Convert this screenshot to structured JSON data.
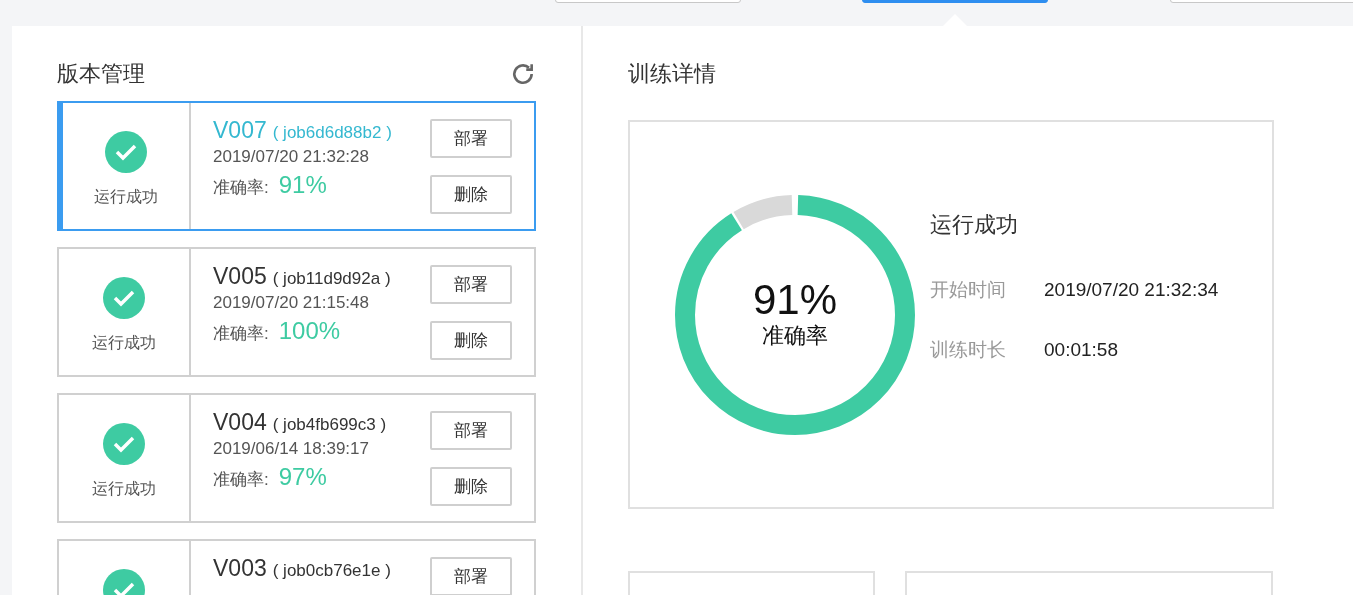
{
  "top_tabs": [
    {
      "selected": false
    },
    {
      "selected": true
    },
    {
      "selected": false
    }
  ],
  "version_panel": {
    "title": "版本管理",
    "versions": [
      {
        "kind": "success",
        "status_label": "运行成功",
        "selected": true,
        "version": "V007",
        "job": "( job6d6d88b2 )",
        "time": "2019/07/20 21:32:28",
        "accuracy_label": "准确率:",
        "accuracy": "91%",
        "buttons": [
          "部署",
          "删除"
        ]
      },
      {
        "kind": "success",
        "status_label": "运行成功",
        "selected": false,
        "version": "V005",
        "job": "( job11d9d92a )",
        "time": "2019/07/20 21:15:48",
        "accuracy_label": "准确率:",
        "accuracy": "100%",
        "buttons": [
          "部署",
          "删除"
        ]
      },
      {
        "kind": "success",
        "status_label": "运行成功",
        "selected": false,
        "version": "V004",
        "job": "( job4fb699c3 )",
        "time": "2019/06/14 18:39:17",
        "accuracy_label": "准确率:",
        "accuracy": "97%",
        "buttons": [
          "部署",
          "删除"
        ]
      },
      {
        "kind": "success",
        "selected": false,
        "version": "V003",
        "job": "( job0cb76e1e )",
        "buttons": [
          "部署"
        ]
      }
    ]
  },
  "detail_panel": {
    "title": "训练详情",
    "accuracy": {
      "level": 0.91,
      "value": "91%",
      "label": "准确率"
    },
    "status": "运行成功",
    "fields": [
      {
        "label": "开始时间",
        "value": "2019/07/20 21:32:34"
      },
      {
        "label": "训练时长",
        "value": "00:01:58"
      }
    ]
  }
}
